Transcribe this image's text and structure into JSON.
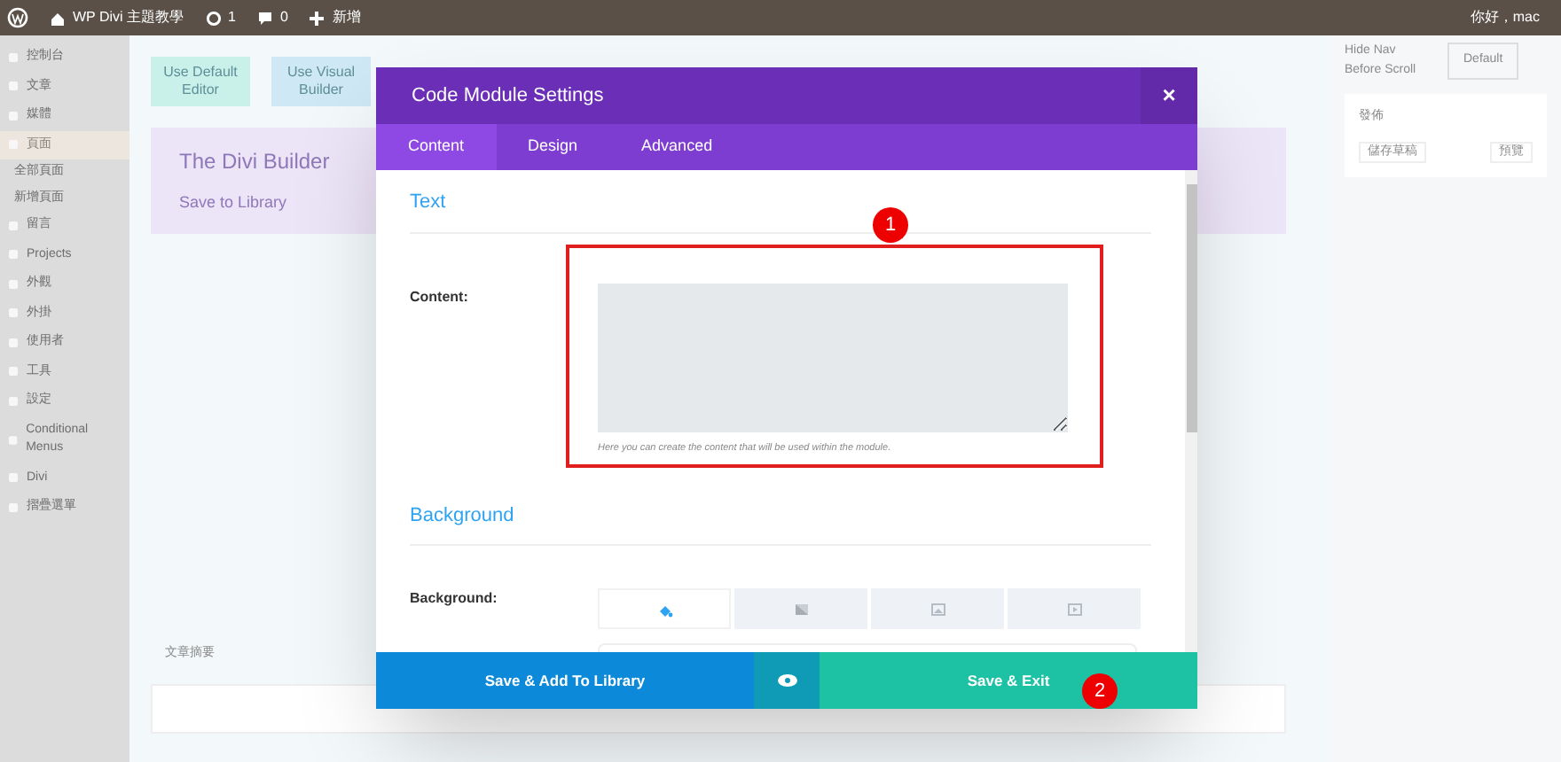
{
  "admin_bar": {
    "site_name": "WP Divi 主題教學",
    "updates": "1",
    "comments": "0",
    "new": "新增",
    "greeting": "你好，mac"
  },
  "sidebar": {
    "items": [
      {
        "label": "控制台",
        "selected": false
      },
      {
        "label": "文章",
        "selected": false
      },
      {
        "label": "媒體",
        "selected": false
      },
      {
        "label": "頁面",
        "selected": true,
        "children": [
          {
            "label": "全部頁面"
          },
          {
            "label": "新增頁面"
          }
        ]
      },
      {
        "label": "留言",
        "selected": false
      },
      {
        "label": "Projects",
        "selected": false
      },
      {
        "label": "外觀",
        "selected": false
      },
      {
        "label": "外掛",
        "selected": false
      },
      {
        "label": "使用者",
        "selected": false
      },
      {
        "label": "工具",
        "selected": false
      },
      {
        "label": "設定",
        "selected": false
      },
      {
        "label": "Conditional Menus",
        "selected": false
      },
      {
        "label": "Divi",
        "selected": false
      },
      {
        "label": "摺疊選單",
        "selected": false
      }
    ]
  },
  "editor_buttons": [
    "Use Default Editor",
    "Use Visual Builder"
  ],
  "builder": {
    "title": "The Divi Builder",
    "save_link": "Save to Library"
  },
  "excerpt_title": "文章摘要",
  "right_panel": {
    "hide_nav_label": "Hide Nav Before Scroll",
    "hide_nav_value": "Default",
    "publish_title": "發佈",
    "save_draft": "儲存草稿",
    "preview": "預覽"
  },
  "modal": {
    "title": "Code Module Settings",
    "close": "×",
    "tabs": [
      {
        "label": "Content",
        "selected": true
      },
      {
        "label": "Design",
        "selected": false
      },
      {
        "label": "Advanced",
        "selected": false
      }
    ],
    "sections": [
      {
        "title": "Text",
        "field_label": "Content:",
        "description": "Here you can create the content that will be used within the module."
      },
      {
        "title": "Background",
        "field_label": "Background:"
      }
    ],
    "background_tabs": [
      {
        "kind": "color",
        "selected": true
      },
      {
        "kind": "gradient",
        "selected": false
      },
      {
        "kind": "image",
        "selected": false
      },
      {
        "kind": "video",
        "selected": false
      }
    ],
    "footer": {
      "library_button": "Save & Add To Library",
      "exit_button": "Save & Exit"
    }
  },
  "annotations": [
    "1",
    "2"
  ]
}
